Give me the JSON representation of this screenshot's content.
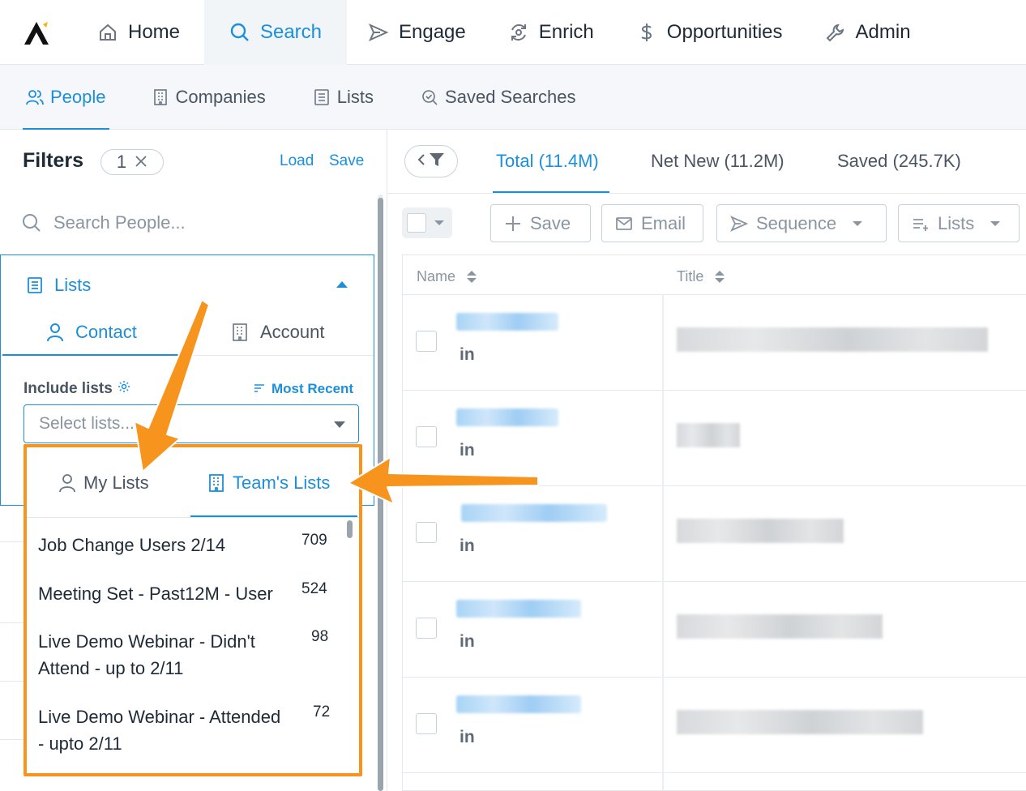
{
  "nav": {
    "items": [
      {
        "label": "Home",
        "icon": "home-icon"
      },
      {
        "label": "Search",
        "icon": "search-icon"
      },
      {
        "label": "Engage",
        "icon": "send-icon"
      },
      {
        "label": "Enrich",
        "icon": "refresh-icon"
      },
      {
        "label": "Opportunities",
        "icon": "dollar-icon"
      },
      {
        "label": "Admin",
        "icon": "wrench-icon"
      }
    ]
  },
  "subnav": {
    "items": [
      {
        "label": "People",
        "icon": "people-icon"
      },
      {
        "label": "Companies",
        "icon": "building-icon"
      },
      {
        "label": "Lists",
        "icon": "list-icon"
      },
      {
        "label": "Saved Searches",
        "icon": "saved-search-icon"
      }
    ]
  },
  "filters": {
    "title": "Filters",
    "count": "1",
    "load": "Load",
    "save": "Save",
    "search_placeholder": "Search People...",
    "lists": {
      "title": "Lists",
      "tab_contact": "Contact",
      "tab_account": "Account",
      "include_label": "Include lists",
      "sort_label": "Most Recent",
      "select_placeholder": "Select lists..."
    }
  },
  "dropdown": {
    "tab_my": "My Lists",
    "tab_team": "Team's Lists",
    "items": [
      {
        "name": "Job Change Users 2/14",
        "count": "709"
      },
      {
        "name": "Meeting Set - Past12M - User",
        "count": "524"
      },
      {
        "name": "Live Demo Webinar - Didn't Attend - up to 2/11",
        "count": "98"
      },
      {
        "name": "Live Demo Webinar - Attended - upto 2/11",
        "count": "72"
      }
    ]
  },
  "results": {
    "tabs": [
      {
        "label": "Total (11.4M)"
      },
      {
        "label": "Net New (11.2M)"
      },
      {
        "label": "Saved (245.7K)"
      }
    ],
    "toolbar": {
      "save": "Save",
      "email": "Email",
      "sequence": "Sequence",
      "lists": "Lists"
    },
    "columns": {
      "name": "Name",
      "title": "Title"
    },
    "linkedin_label": "in"
  },
  "colors": {
    "accent": "#1b8fdc",
    "annotation": "#f7941d"
  }
}
